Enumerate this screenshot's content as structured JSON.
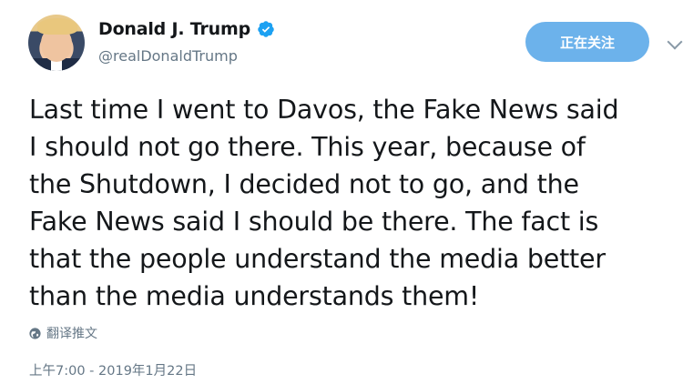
{
  "user": {
    "display_name": "Donald J. Trump",
    "handle": "@realDonaldTrump",
    "verified": true
  },
  "follow_button": {
    "label": "正在关注"
  },
  "tweet": {
    "text": "Last time I went to Davos, the Fake News said\nI should not go there. This year, because of\nthe Shutdown, I decided not to go, and the\nFake News said I should be there. The fact is\nthat the people understand the media better\nthan the media understands them!"
  },
  "translate": {
    "label": "翻译推文"
  },
  "timestamp": "上午7:00 - 2019年1月22日",
  "colors": {
    "follow_button": "#6cb2eb",
    "verified_badge": "#1da1f2",
    "secondary_text": "#657786"
  }
}
